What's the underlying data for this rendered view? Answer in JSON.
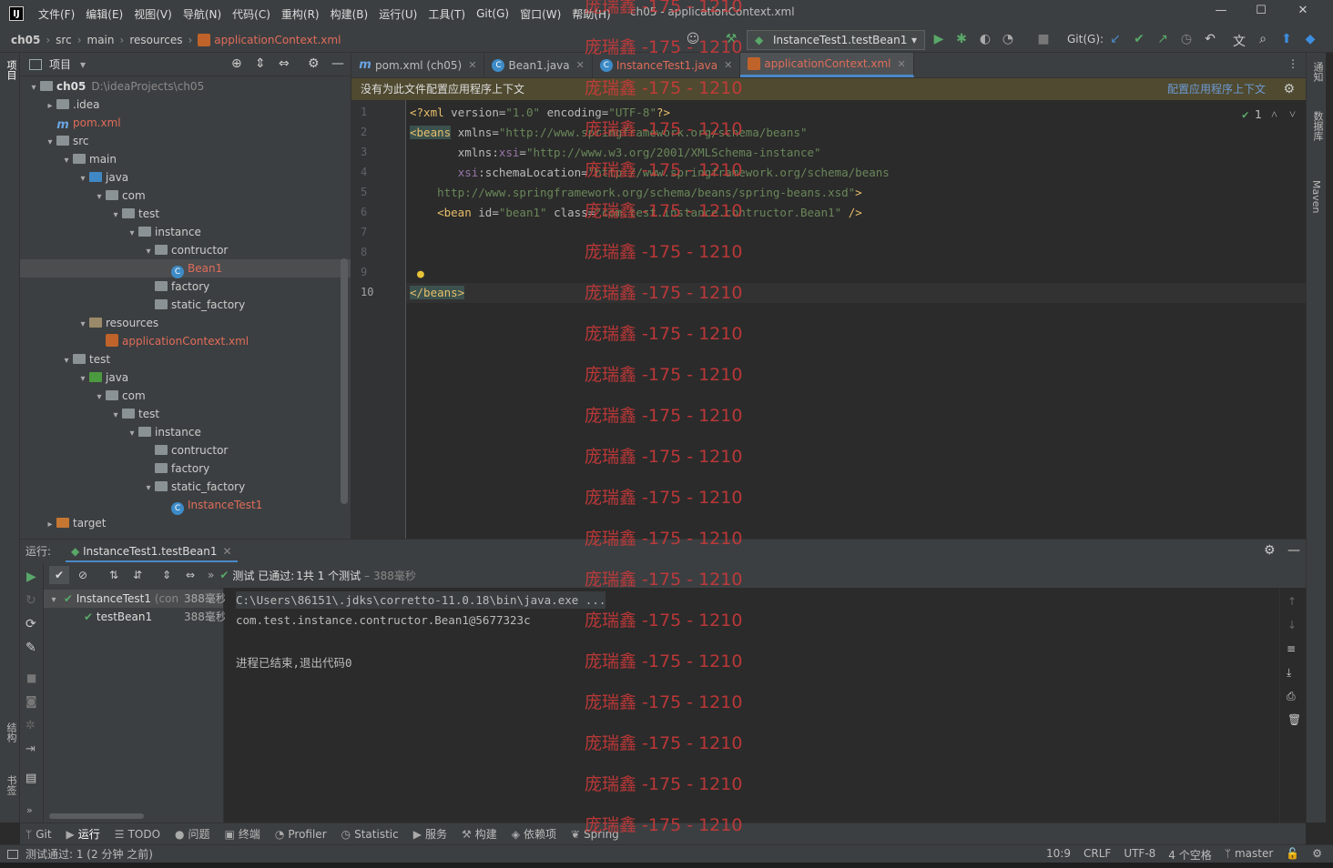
{
  "title_bar": {
    "menus": [
      "文件(F)",
      "编辑(E)",
      "视图(V)",
      "导航(N)",
      "代码(C)",
      "重构(R)",
      "构建(B)",
      "运行(U)",
      "工具(T)",
      "Git(G)",
      "窗口(W)",
      "帮助(H)"
    ],
    "window_title": "ch05 - applicationContext.xml"
  },
  "nav": {
    "breadcrumbs": [
      "ch05",
      "src",
      "main",
      "resources",
      "applicationContext.xml"
    ],
    "run_config": "InstanceTest1.testBean1",
    "git_label": "Git(G):"
  },
  "left_stripe": {
    "project": "项目",
    "structure": "结构",
    "bookmarks": "书签"
  },
  "right_stripe": {
    "notifications": "通知",
    "database": "数据库",
    "maven": "Maven"
  },
  "project_panel": {
    "title": "项目",
    "tree": [
      {
        "label": "ch05",
        "extra": "D:\\ideaProjects\\ch05",
        "depth": 0,
        "arrow": "▾",
        "icon": "f-grey",
        "bold": true
      },
      {
        "label": ".idea",
        "depth": 1,
        "arrow": "▸",
        "icon": "f-grey"
      },
      {
        "label": "pom.xml",
        "depth": 1,
        "arrow": "",
        "icon": "maven",
        "red": true
      },
      {
        "label": "src",
        "depth": 1,
        "arrow": "▾",
        "icon": "f-grey"
      },
      {
        "label": "main",
        "depth": 2,
        "arrow": "▾",
        "icon": "f-grey"
      },
      {
        "label": "java",
        "depth": 3,
        "arrow": "▾",
        "icon": "f-blue"
      },
      {
        "label": "com",
        "depth": 4,
        "arrow": "▾",
        "icon": "f-grey"
      },
      {
        "label": "test",
        "depth": 5,
        "arrow": "▾",
        "icon": "f-grey"
      },
      {
        "label": "instance",
        "depth": 6,
        "arrow": "▾",
        "icon": "f-grey"
      },
      {
        "label": "contructor",
        "depth": 7,
        "arrow": "▾",
        "icon": "f-grey"
      },
      {
        "label": "Bean1",
        "depth": 8,
        "arrow": "",
        "icon": "java",
        "red": true,
        "selected": true
      },
      {
        "label": "factory",
        "depth": 7,
        "arrow": "",
        "icon": "f-grey"
      },
      {
        "label": "static_factory",
        "depth": 7,
        "arrow": "",
        "icon": "f-grey"
      },
      {
        "label": "resources",
        "depth": 3,
        "arrow": "▾",
        "icon": "f-res"
      },
      {
        "label": "applicationContext.xml",
        "depth": 4,
        "arrow": "",
        "icon": "xml",
        "red": true
      },
      {
        "label": "test",
        "depth": 2,
        "arrow": "▾",
        "icon": "f-grey"
      },
      {
        "label": "java",
        "depth": 3,
        "arrow": "▾",
        "icon": "f-green"
      },
      {
        "label": "com",
        "depth": 4,
        "arrow": "▾",
        "icon": "f-grey"
      },
      {
        "label": "test",
        "depth": 5,
        "arrow": "▾",
        "icon": "f-grey"
      },
      {
        "label": "instance",
        "depth": 6,
        "arrow": "▾",
        "icon": "f-grey"
      },
      {
        "label": "contructor",
        "depth": 7,
        "arrow": "",
        "icon": "f-grey"
      },
      {
        "label": "factory",
        "depth": 7,
        "arrow": "",
        "icon": "f-grey"
      },
      {
        "label": "static_factory",
        "depth": 7,
        "arrow": "▾",
        "icon": "f-grey"
      },
      {
        "label": "InstanceTest1",
        "depth": 8,
        "arrow": "",
        "icon": "java",
        "red": true
      },
      {
        "label": "target",
        "depth": 1,
        "arrow": "▸",
        "icon": "f-orange"
      }
    ]
  },
  "editor": {
    "tabs": [
      {
        "label": "pom.xml (ch05)",
        "icon": "maven",
        "active": false
      },
      {
        "label": "Bean1.java",
        "icon": "java",
        "active": false
      },
      {
        "label": "InstanceTest1.java",
        "icon": "java",
        "active": false
      },
      {
        "label": "applicationContext.xml",
        "icon": "xml",
        "active": true
      }
    ],
    "banner": "没有为此文件配置应用程序上下文",
    "banner_link": "配置应用程序上下文",
    "inspection_count": "1",
    "line_numbers": [
      "1",
      "2",
      "3",
      "4",
      "5",
      "6",
      "7",
      "8",
      "9",
      "10"
    ]
  },
  "run_panel": {
    "label": "运行:",
    "tab": "InstanceTest1.testBean1",
    "status_prefix": "测试 已通过:",
    "status_count": "1共 1 个测试",
    "status_time": "– 388毫秒",
    "tree": [
      {
        "label": "InstanceTest1",
        "extra": "(con",
        "time": "388毫秒"
      },
      {
        "label": "testBean1",
        "time": "388毫秒"
      }
    ],
    "console": [
      "C:\\Users\\86151\\.jdks\\corretto-11.0.18\\bin\\java.exe ...",
      "com.test.instance.contructor.Bean1@5677323c",
      "",
      "进程已结束,退出代码0"
    ]
  },
  "tool_tabs": [
    {
      "label": "Git",
      "icon": "ᛘ"
    },
    {
      "label": "运行",
      "icon": "▶",
      "active": true
    },
    {
      "label": "TODO",
      "icon": "☰"
    },
    {
      "label": "问题",
      "icon": "●"
    },
    {
      "label": "终端",
      "icon": "▣"
    },
    {
      "label": "Profiler",
      "icon": "◔"
    },
    {
      "label": "Statistic",
      "icon": "◷"
    },
    {
      "label": "服务",
      "icon": "▶"
    },
    {
      "label": "构建",
      "icon": "⚒"
    },
    {
      "label": "依赖项",
      "icon": "◈"
    },
    {
      "label": "Spring",
      "icon": "❦"
    }
  ],
  "status_bar": {
    "message": "测试通过: 1 (2 分钟 之前)",
    "position": "10:9",
    "line_sep": "CRLF",
    "encoding": "UTF-8",
    "indent": "4 个空格",
    "branch": "master"
  },
  "watermark": "庞瑞鑫 -175 - 1210",
  "colors": {
    "accent": "#4a88c7",
    "pass": "#59a869",
    "watermark": "#d33a3a"
  }
}
